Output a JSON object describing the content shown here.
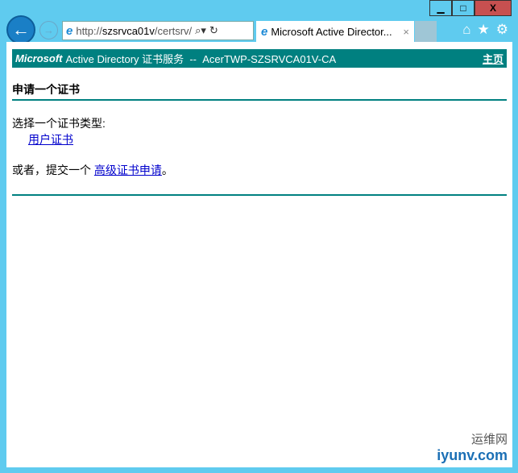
{
  "window": {
    "minimize": "▁",
    "maximize": "□",
    "close": "X"
  },
  "browser": {
    "address_prefix": "http://",
    "address_host": "szsrvca01v",
    "address_path": "/certsrv/",
    "tab_title": "Microsoft Active Director...",
    "tab_close": "×"
  },
  "banner": {
    "brand": "Microsoft",
    "title": "Active Directory 证书服务  --  AcerTWP-SZSRVCA01V-CA",
    "home_link": "主页"
  },
  "page": {
    "heading": "申请一个证书",
    "prompt": "选择一个证书类型:",
    "user_cert_link": "用户证书",
    "or_text": "或者，提交一个 ",
    "advanced_link": "高级证书申请",
    "period": "。"
  },
  "watermark": {
    "cn": "运维网",
    "en": "iyunv.com"
  }
}
